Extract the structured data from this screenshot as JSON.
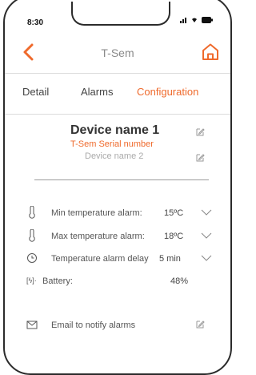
{
  "status_bar": {
    "time": "8:30"
  },
  "header": {
    "title": "T-Sem"
  },
  "tabs": [
    {
      "label": "Detail",
      "active": false
    },
    {
      "label": "Alarms",
      "active": false
    },
    {
      "label": "Configuration",
      "active": true
    }
  ],
  "device": {
    "name": "Device name 1",
    "serial": "T-Sem Serial number",
    "name2": "Device name 2"
  },
  "settings": {
    "min_temp": {
      "label": "Min temperature alarm:",
      "value": "15ºC"
    },
    "max_temp": {
      "label": "Max temperature alarm:",
      "value": "18ºC"
    },
    "delay": {
      "label": "Temperature alarm delay",
      "value": "5 min"
    },
    "battery": {
      "label": "Battery:",
      "value": "48%",
      "icon_text": "[ϟ]·"
    },
    "email": {
      "label": "Email to notify alarms"
    }
  },
  "colors": {
    "accent": "#ef6a2c",
    "text": "#333333",
    "muted": "#aaaaaa"
  }
}
